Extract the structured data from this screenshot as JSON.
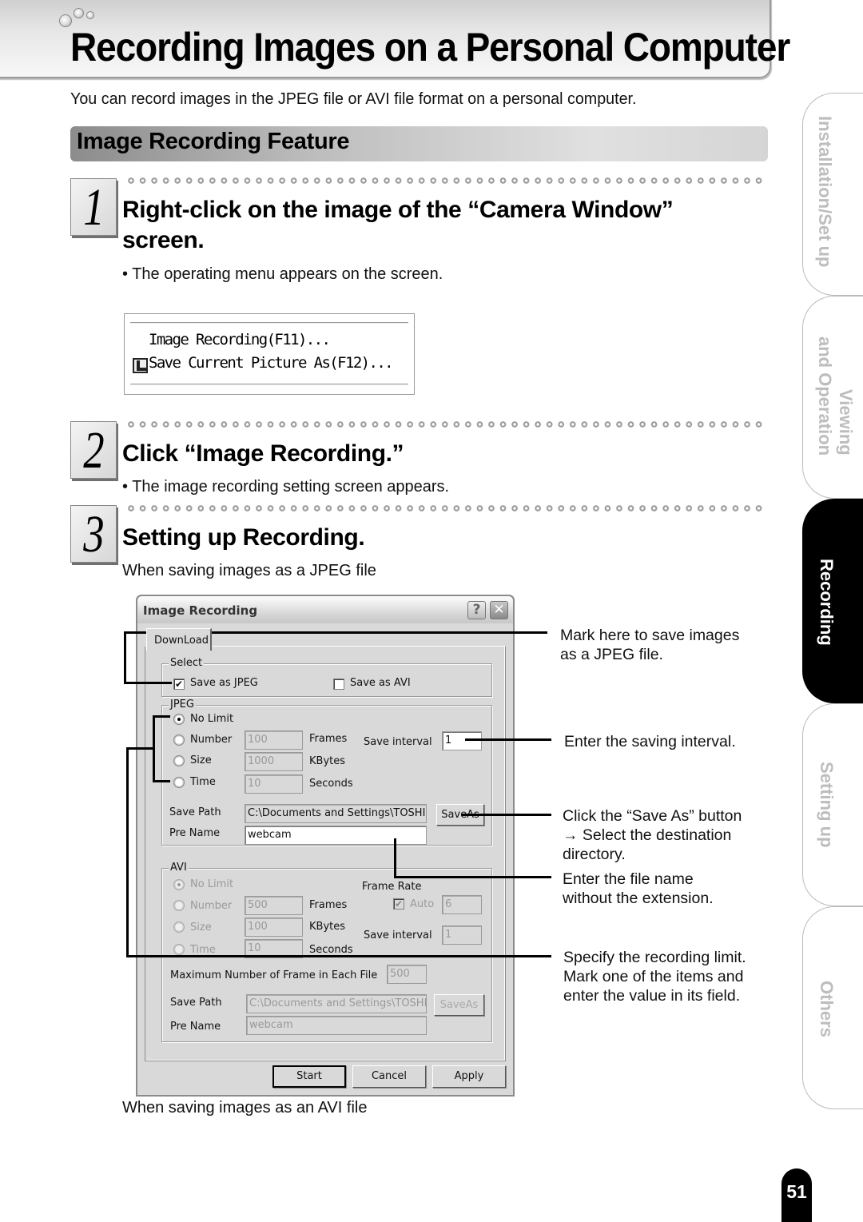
{
  "header": {
    "title": "Recording Images on a Personal Computer",
    "intro": "You can record images in the JPEG file or AVI file format on a personal computer."
  },
  "section": {
    "title": "Image Recording Feature"
  },
  "steps": [
    {
      "number": "1",
      "title_line1": "Right-click on the image of the “Camera Window”",
      "title_line2": "screen.",
      "note": "• The operating menu appears on the screen."
    },
    {
      "number": "2",
      "title": "Click “Image Recording.”",
      "note": "• The image recording setting screen appears."
    },
    {
      "number": "3",
      "title": "Setting up Recording.",
      "note": "When saving images as a JPEG file"
    }
  ],
  "context_menu": {
    "items": [
      {
        "label": "Image Recording(F11)...",
        "icon": null
      },
      {
        "label": "Save Current Picture As(F12)...",
        "icon": "save-picture-icon"
      }
    ]
  },
  "dialog": {
    "title": "Image Recording",
    "help_label": "?",
    "close_label": "✕",
    "tab": "DownLoad",
    "select_group": {
      "label": "Select",
      "save_jpeg": {
        "label": "Save as JPEG",
        "checked": true
      },
      "save_avi": {
        "label": "Save as AVI",
        "checked": false
      }
    },
    "jpeg_group": {
      "label": "JPEG",
      "options": [
        {
          "label": "No Limit",
          "selected": true,
          "value": null,
          "unit": null
        },
        {
          "label": "Number",
          "selected": false,
          "value": "100",
          "unit": "Frames"
        },
        {
          "label": "Size",
          "selected": false,
          "value": "1000",
          "unit": "KBytes"
        },
        {
          "label": "Time",
          "selected": false,
          "value": "10",
          "unit": "Seconds"
        }
      ],
      "save_interval_label": "Save interval",
      "save_interval_value": "1",
      "save_path_label": "Save Path",
      "save_path_value": "C:\\Documents and Settings\\TOSHIB",
      "save_as_label": "SaveAs",
      "pre_name_label": "Pre Name",
      "pre_name_value": "webcam"
    },
    "avi_group": {
      "label": "AVI",
      "options": [
        {
          "label": "No Limit",
          "selected": true,
          "value": null,
          "unit": null
        },
        {
          "label": "Number",
          "selected": false,
          "value": "500",
          "unit": "Frames"
        },
        {
          "label": "Size",
          "selected": false,
          "value": "100",
          "unit": "KBytes"
        },
        {
          "label": "Time",
          "selected": false,
          "value": "10",
          "unit": "Seconds"
        }
      ],
      "frame_rate_label": "Frame Rate",
      "auto_label": "Auto",
      "auto_checked": true,
      "frame_rate_value": "6",
      "save_interval_label": "Save interval",
      "save_interval_value": "1",
      "max_frames_label": "Maximum Number of Frame in Each File",
      "max_frames_value": "500",
      "save_path_label": "Save Path",
      "save_path_value": "C:\\Documents and Settings\\TOSHIB",
      "save_as_label": "SaveAs",
      "pre_name_label": "Pre Name",
      "pre_name_value": "webcam"
    },
    "buttons": {
      "start": "Start",
      "cancel": "Cancel",
      "apply": "Apply"
    }
  },
  "callouts": {
    "jpeg_mark": [
      "Mark here to save images",
      "as a JPEG file."
    ],
    "interval": [
      "Enter the saving interval."
    ],
    "save_as": [
      "Click the “Save As” button",
      "→ Select the destination",
      "directory."
    ],
    "file_name": [
      "Enter the file name",
      "without the extension."
    ],
    "limit": [
      "Specify the recording limit.",
      "Mark one of the items and",
      "enter the value in its field."
    ]
  },
  "avi_caption": "When saving images as an AVI file",
  "side_tabs": [
    {
      "label": "Installation/Set up",
      "active": false
    },
    {
      "label": "Viewing and Operation",
      "line1": "Viewing",
      "line2": "and Operation",
      "active": false
    },
    {
      "label": "Recording",
      "active": true
    },
    {
      "label": "Setting up",
      "active": false
    },
    {
      "label": "Others",
      "active": false
    }
  ],
  "page_number": "51"
}
